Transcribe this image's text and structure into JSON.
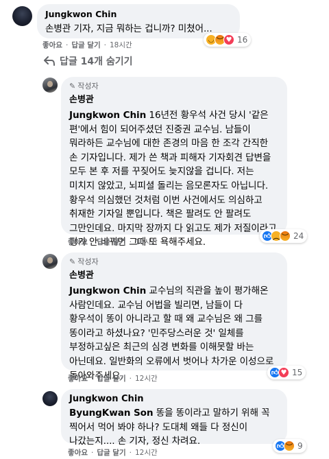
{
  "comments": [
    {
      "author": "Jungkwon Chin",
      "text": "손병관 기자, 지금 뭐하는 겁니까? 미쳤어...",
      "actions": {
        "like": "좋아요",
        "reply": "답글 달기",
        "time": "18시간"
      },
      "reaction_count": "16",
      "reaction_icons": [
        "haha-icon",
        "angry-icon",
        "love-icon"
      ]
    },
    {
      "badge": "작성자",
      "author": "손병관",
      "mention": "Jungkwon Chin",
      "text": "16년전 황우석 사건 당시 '같은 편'에서 힘이 되어주셨던 진중권 교수님. 남들이 뭐라하든 교수님에 대한 존경의 마음 한 조각 간직한 손 기자입니다. 제가 쓴 책과 피해자 기자회견 답변을 모두 본 후 저를 꾸짖어도 늦지않을 겁니다. 저는 미치지 않았고, 뇌피셜 돌리는 음모론자도 아닙니다. 황우석 의심했던 것처럼 이번 사건에서도 의심하고 취재한 기자일 뿐입니다. 책은 팔려도 안 팔려도 그만인데요. 마지막 장까지 다 읽고도 제가 저질이라고 평가 안 바뀌면 그때 또 욕해주세요.",
      "actions": {
        "like": "좋아요",
        "reply": "답글 달기",
        "time": "16시간"
      },
      "reaction_count": "24",
      "reaction_icons": [
        "like-icon",
        "sad-icon",
        "angry-icon"
      ]
    },
    {
      "badge": "작성자",
      "author": "손병관",
      "mention": "Jungkwon Chin",
      "text": "교수님의 직관을 높이 평가해온 사람인데요. 교수님 어법을 빌리면, 남들이 다 황우석이 똥이 아니라고 할 때 왜 교수님은 왜 그를 똥이라고 하셨나요? '민주당스러운 것' 일체를 부정하고싶은 최근의 심경 변화를 이해못할 바는 아닌데요. 일반화의 오류에서 벗어나 차가운 이성으로 돌아와주세요.",
      "actions": {
        "like": "좋아요",
        "reply": "답글 달기",
        "time": "12시간"
      },
      "reaction_count": "15",
      "reaction_icons": [
        "like-icon",
        "love-icon"
      ]
    },
    {
      "author": "Jungkwon Chin",
      "mention": "ByungKwan Son",
      "text": "똥을 똥이라고 말하기 위해 꼭 찍어서 먹어 봐야 하나? 도대체 왜들 다 정신이 나갔는지.... 손 기자, 정신 차려요.",
      "actions": {
        "like": "좋아요",
        "reply": "답글 달기",
        "time": "12시간"
      },
      "reaction_count": "9",
      "reaction_icons": [
        "like-icon",
        "angry-icon"
      ]
    }
  ],
  "hidden_replies_label": "답글 14개 숨기기"
}
